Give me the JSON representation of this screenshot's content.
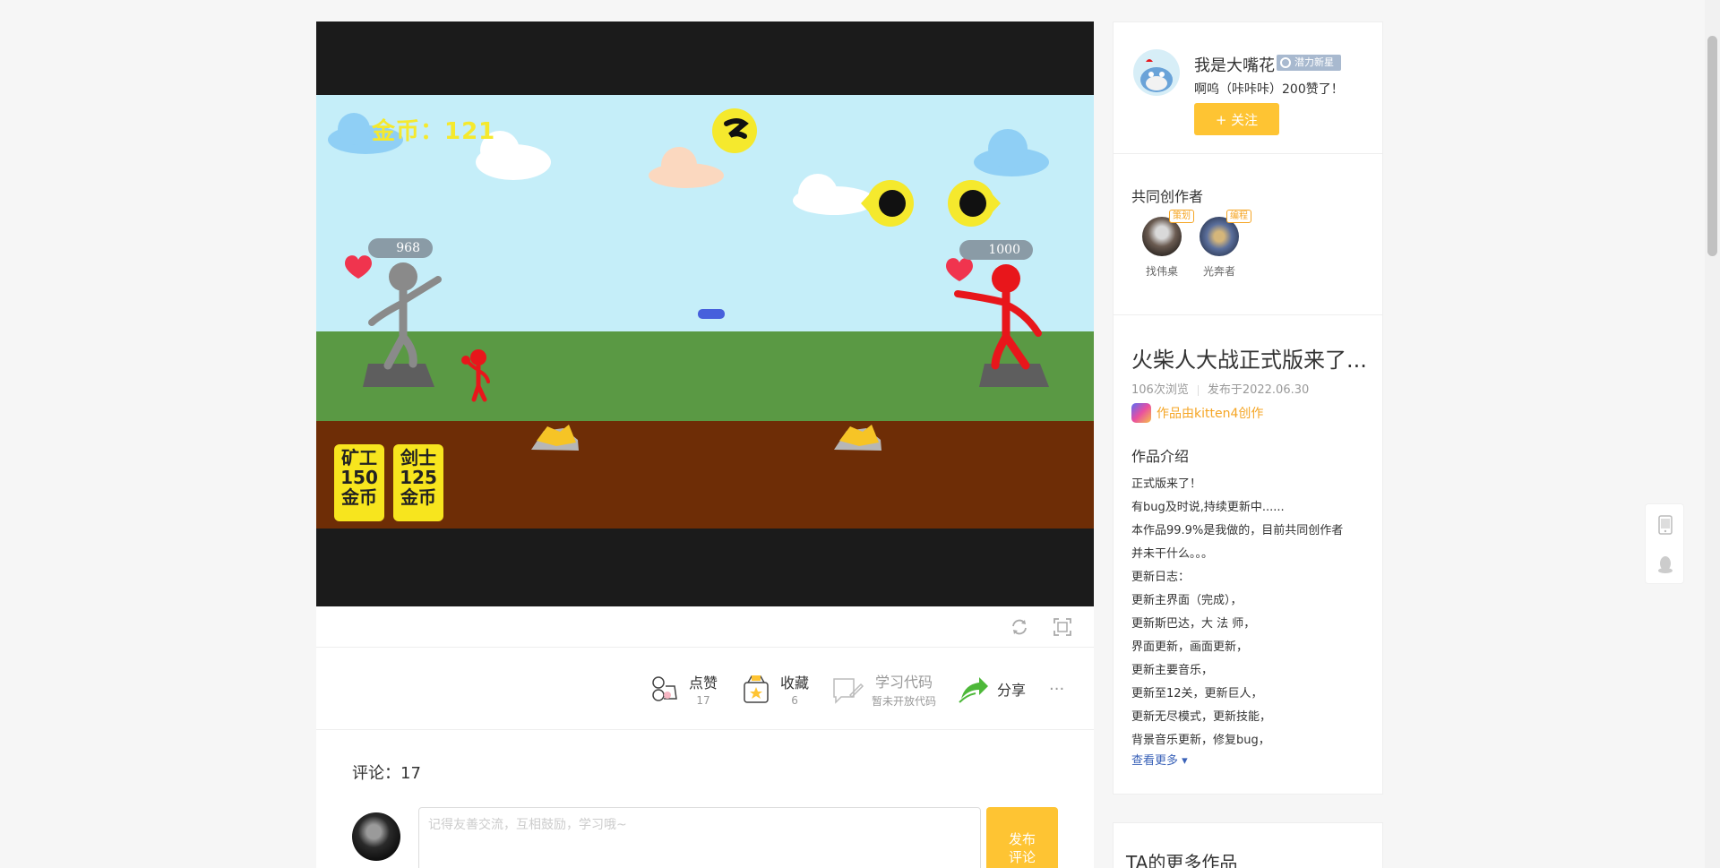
{
  "game": {
    "coins_label": "金币：121",
    "hp_left": "968",
    "hp_right": "1000",
    "cards": [
      {
        "name": "矿工",
        "cost": "150",
        "unit": "金币"
      },
      {
        "name": "剑士",
        "cost": "125",
        "unit": "金币"
      }
    ]
  },
  "actions": {
    "like": {
      "label": "点赞",
      "count": "17"
    },
    "favorite": {
      "label": "收藏",
      "count": "6"
    },
    "learn": {
      "label": "学习代码",
      "sub": "暂未开放代码"
    },
    "share": {
      "label": "分享"
    },
    "more": "···"
  },
  "comments": {
    "title": "评论：17",
    "placeholder": "记得友善交流，互相鼓励，学习哦~",
    "submit_line1": "发布",
    "submit_line2": "评论"
  },
  "author": {
    "name": "我是大嘴花",
    "badge": "潜力新星",
    "bio": "啊呜（咔咔咔）200赞了！",
    "follow_label": "+ 关注"
  },
  "cocreators": {
    "title": "共同创作者",
    "items": [
      {
        "name": "找伟桌",
        "tag": "策划"
      },
      {
        "name": "光奔者",
        "tag": "编程"
      }
    ]
  },
  "work": {
    "title": "火柴人大战正式版来了...",
    "views": "106次浏览",
    "published": "发布于2022.06.30",
    "made_with": "作品由kitten4创作",
    "intro_title": "作品介绍",
    "intro_lines": [
      "正式版来了！",
      "有bug及时说,持续更新中......",
      "本作品99.9%是我做的，目前共同创作者",
      "并未干什么。。。",
      "更新日志：",
      "更新主界面（完成），",
      "更新斯巴达，大 法 师，",
      "界面更新，画面更新，",
      "更新主要音乐，",
      "更新至12关，更新巨人，",
      "更新无尽模式，更新技能，",
      "背景音乐更新，修复bug，"
    ],
    "see_more": "查看更多 ▾"
  },
  "more_works": {
    "title": "TA的更多作品"
  },
  "colors": {
    "accent": "#fec433",
    "link": "#3a62b8",
    "tag": "#f5a524"
  }
}
